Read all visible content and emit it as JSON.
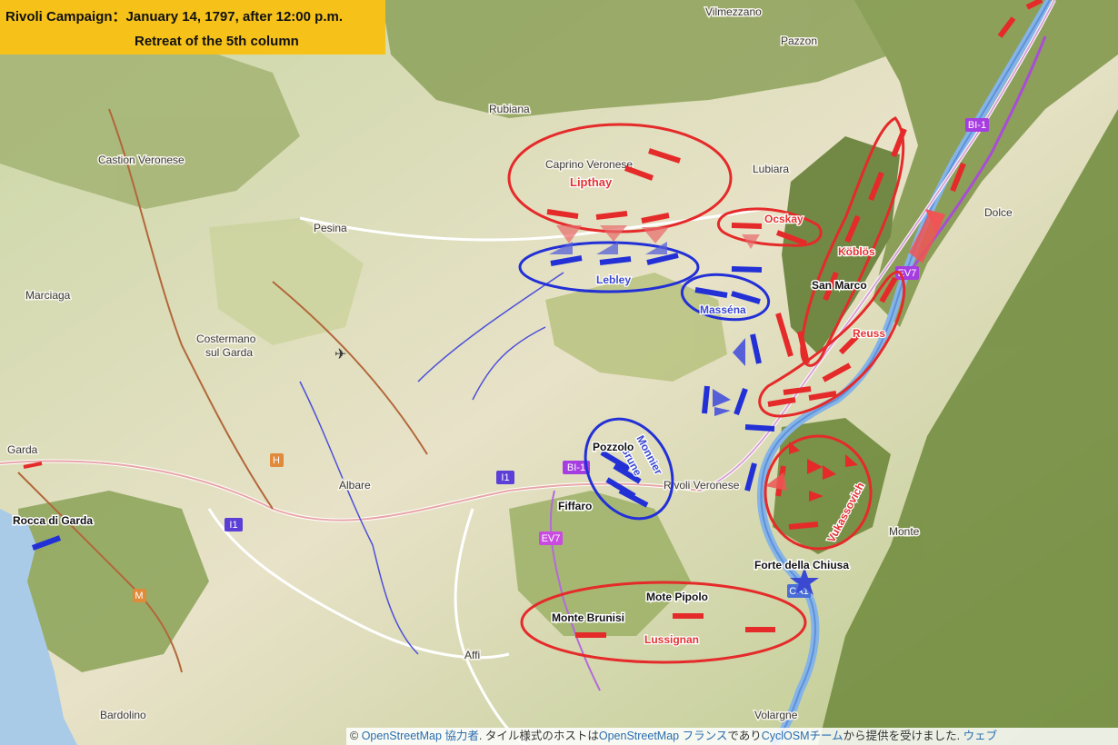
{
  "title": {
    "line1": "Rivoli Campaign：January 14, 1797, after 12:00 p.m.",
    "line2": "Retreat of the 5th column"
  },
  "colors": {
    "austrian": "#e52a2a",
    "french": "#2230d6",
    "title_bg": "#f6c21a",
    "water": "#9fc6e8",
    "river": "#79a9e0"
  },
  "places": {
    "vilmezzano": "Vilmezzano",
    "pazzon": "Pazzon",
    "rubiana": "Rubiana",
    "castion": "Castion Veronese",
    "caprino": "Caprino Veronese",
    "lubiara": "Lubiara",
    "pesina": "Pesina",
    "dolce": "Dolce",
    "marciaga": "Marciaga",
    "costermano1": "Costermano",
    "costermano2": "sul Garda",
    "garda": "Garda",
    "albare": "Albare",
    "rivoli": "Rivoli Veronese",
    "monte": "Monte",
    "affi": "Affi",
    "volargne": "Volargne",
    "bardolino": "Bardolino"
  },
  "battle_labels": {
    "san_marco": "San Marco",
    "pozzolo": "Pozzolo",
    "fiffaro": "Fiffaro",
    "rocca": "Rocca di Garda",
    "forte": "Forte della Chiusa",
    "mote_pipolo": "Mote Pipolo",
    "monte_brunisi": "Monte Brunisi"
  },
  "units": {
    "austrian": {
      "lipthay": "Lipthay",
      "ocskay": "Ocskay",
      "koblos": "Köblös",
      "reuss": "Reuss",
      "vukassovich": "Vukassovich",
      "lussignan": "Lussignan"
    },
    "french": {
      "lebley": "Lebley",
      "massena": "Masséna",
      "brune": "Brune",
      "monnier": "Monnier"
    }
  },
  "road_shields": {
    "bi1_east": "BI-1",
    "bi1_west": "BI-1",
    "ev7_east": "EV7",
    "ev7_west": "EV7",
    "i1_a": "I1",
    "i1_b": "I1",
    "ca1": "CA1",
    "h": "H",
    "m": "M"
  },
  "attribution": {
    "prefix": "© ",
    "osm1": "OpenStreetMap 協力者",
    "mid1": ". タイル様式のホストは",
    "osm2": "OpenStreetMap フランス",
    "mid2": "であり",
    "cyclosm": "CyclOSMチーム",
    "mid3": "から提供を受けました. ",
    "tail": "ウェブ"
  }
}
